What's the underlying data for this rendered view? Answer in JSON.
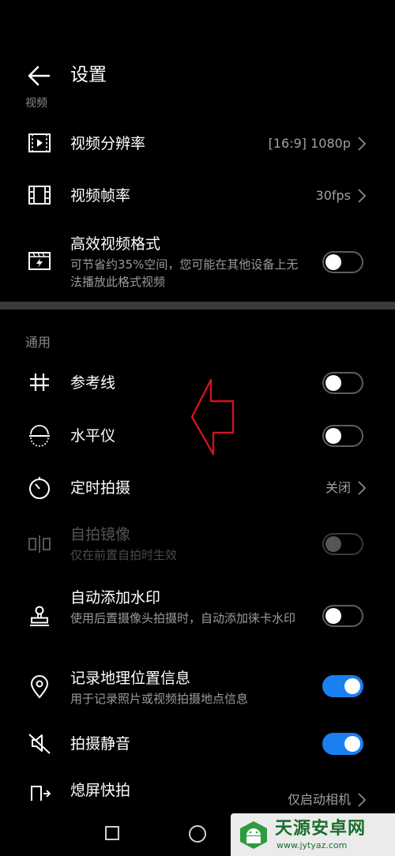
{
  "header": {
    "title": "设置"
  },
  "section_video": "视频",
  "video": {
    "resolution": {
      "label": "视频分辨率",
      "value": "[16:9] 1080p"
    },
    "framerate": {
      "label": "视频帧率",
      "value": "30fps"
    },
    "efficient_format": {
      "label": "高效视频格式",
      "desc": "可节省约35%空间，您可能在其他设备上无法播放此格式视频",
      "on": false
    }
  },
  "section_general": "通用",
  "general": {
    "grid": {
      "label": "参考线",
      "on": false
    },
    "level": {
      "label": "水平仪",
      "on": false
    },
    "timer": {
      "label": "定时拍摄",
      "value": "关闭"
    },
    "mirror": {
      "label": "自拍镜像",
      "desc": "仅在前置自拍时生效",
      "on": false,
      "disabled": true
    },
    "watermark": {
      "label": "自动添加水印",
      "desc": "使用后置摄像头拍摄时，自动添加徕卡水印",
      "on": false
    },
    "location": {
      "label": "记录地理位置信息",
      "desc": "用于记录照片或视频拍摄地点信息",
      "on": true
    },
    "mute": {
      "label": "拍摄静音",
      "on": true
    },
    "quick_snap": {
      "label": "熄屏快拍",
      "value": "仅启动相机"
    }
  },
  "site_watermark": {
    "name": "天源安卓网",
    "url": "www.jytyaz.com"
  },
  "colors": {
    "accent": "#1a7ff0",
    "annotation": "#d0141c"
  }
}
